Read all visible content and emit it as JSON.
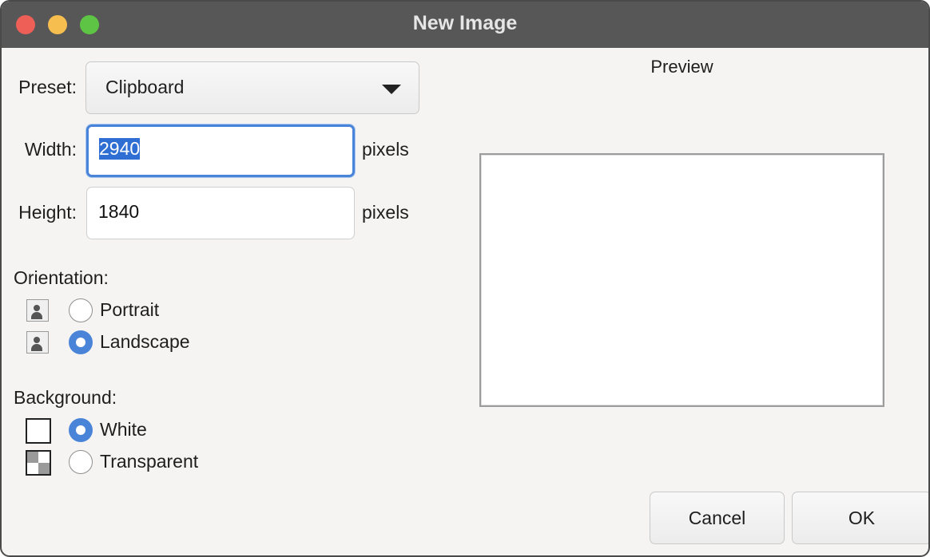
{
  "window": {
    "title": "New Image"
  },
  "preset": {
    "label": "Preset:",
    "value": "Clipboard"
  },
  "width": {
    "label": "Width:",
    "value": "2940",
    "unit": "pixels"
  },
  "height": {
    "label": "Height:",
    "value": "1840",
    "unit": "pixels"
  },
  "orientation": {
    "label": "Orientation:",
    "options": [
      {
        "label": "Portrait",
        "selected": false,
        "icon": "portrait-icon"
      },
      {
        "label": "Landscape",
        "selected": true,
        "icon": "landscape-icon"
      }
    ]
  },
  "background": {
    "label": "Background:",
    "options": [
      {
        "label": "White",
        "selected": true,
        "icon": "white-swatch-icon"
      },
      {
        "label": "Transparent",
        "selected": false,
        "icon": "transparent-swatch-icon"
      }
    ]
  },
  "preview": {
    "label": "Preview"
  },
  "buttons": {
    "cancel": "Cancel",
    "ok": "OK"
  },
  "colors": {
    "accent": "#4a84d8",
    "titlebar": "#575757",
    "close": "#ee5f57",
    "minimize": "#f5be4f",
    "maximize": "#5ec445"
  }
}
